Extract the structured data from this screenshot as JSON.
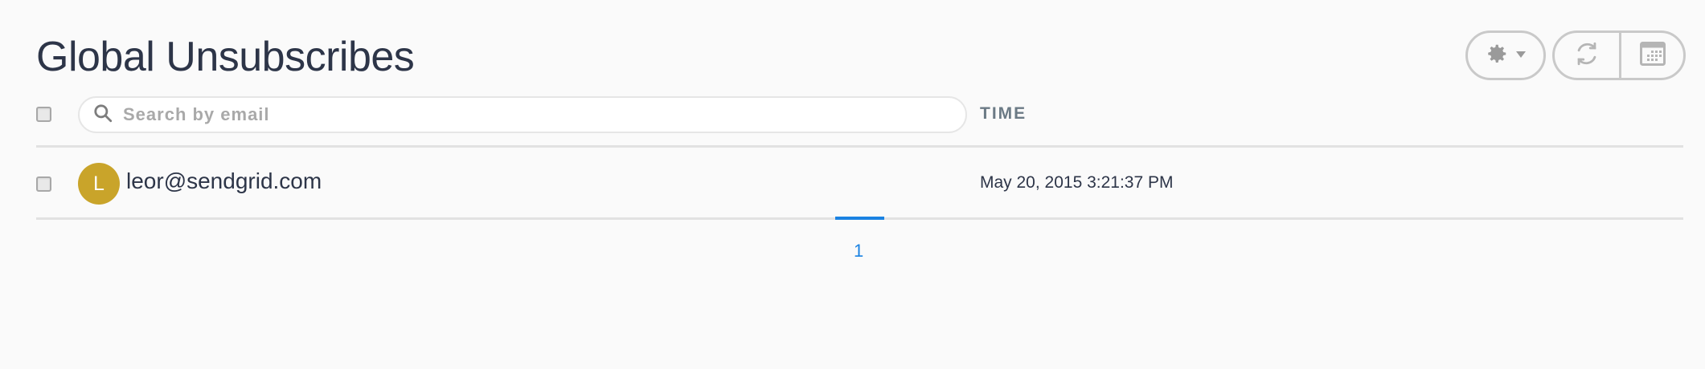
{
  "page": {
    "title": "Global Unsubscribes"
  },
  "toolbar": {
    "settings_icon": "gear-icon",
    "caret_icon": "chevron-down-icon",
    "refresh_icon": "refresh-icon",
    "calendar_icon": "calendar-icon"
  },
  "search": {
    "placeholder": "Search by email",
    "value": ""
  },
  "columns": {
    "time": "TIME"
  },
  "rows": [
    {
      "avatar_letter": "L",
      "email": "leor@sendgrid.com",
      "time": "May 20, 2015 3:21:37 PM",
      "avatar_color": "#c9a42a"
    }
  ],
  "pagination": {
    "current": "1"
  },
  "colors": {
    "accent": "#1a82e2",
    "title": "#2d3548",
    "border": "#c9c9c9"
  }
}
